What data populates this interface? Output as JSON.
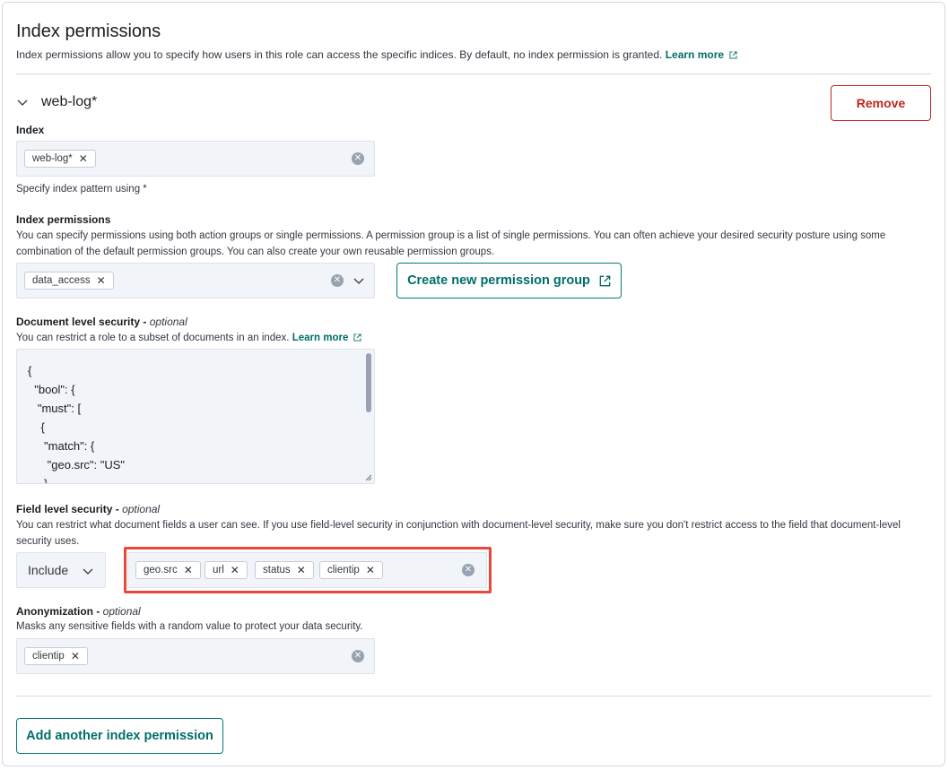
{
  "header": {
    "title": "Index permissions",
    "description": "Index permissions allow you to specify how users in this role can access the specific indices. By default, no index permission is granted.",
    "learn_more": "Learn more"
  },
  "permission": {
    "name": "web-log*",
    "remove_label": "Remove",
    "index": {
      "label": "Index",
      "pills": [
        "web-log*"
      ],
      "help": "Specify index pattern using *"
    },
    "index_permissions": {
      "label": "Index permissions",
      "help": "You can specify permissions using both action groups or single permissions. A permission group is a list of single permissions. You can often achieve your desired security posture using some combination of the default permission groups. You can also create your own reusable permission groups.",
      "pills": [
        "data_access"
      ],
      "create_label": "Create new permission group"
    },
    "dls": {
      "label": "Document level security",
      "optional": "optional",
      "help": "You can restrict a role to a subset of documents in an index.",
      "learn_more": "Learn more",
      "code": "{\n  \"bool\": {\n   \"must\": [\n    {\n     \"match\": {\n      \"geo.src\": \"US\"\n     }"
    },
    "fls": {
      "label": "Field level security",
      "optional": "optional",
      "help": "You can restrict what document fields a user can see. If you use field-level security in conjunction with document-level security, make sure you don't restrict access to the field that document-level security uses.",
      "mode": "Include",
      "pills": [
        "geo.src",
        "url",
        "status",
        "clientip"
      ]
    },
    "anonymization": {
      "label": "Anonymization",
      "optional": "optional",
      "help": "Masks any sensitive fields with a random value to protect your data security.",
      "pills": [
        "clientip"
      ]
    }
  },
  "footer": {
    "add_label": "Add another index permission"
  },
  "colors": {
    "accent": "#006e69",
    "danger": "#bd271e",
    "highlight": "#e9473a"
  }
}
